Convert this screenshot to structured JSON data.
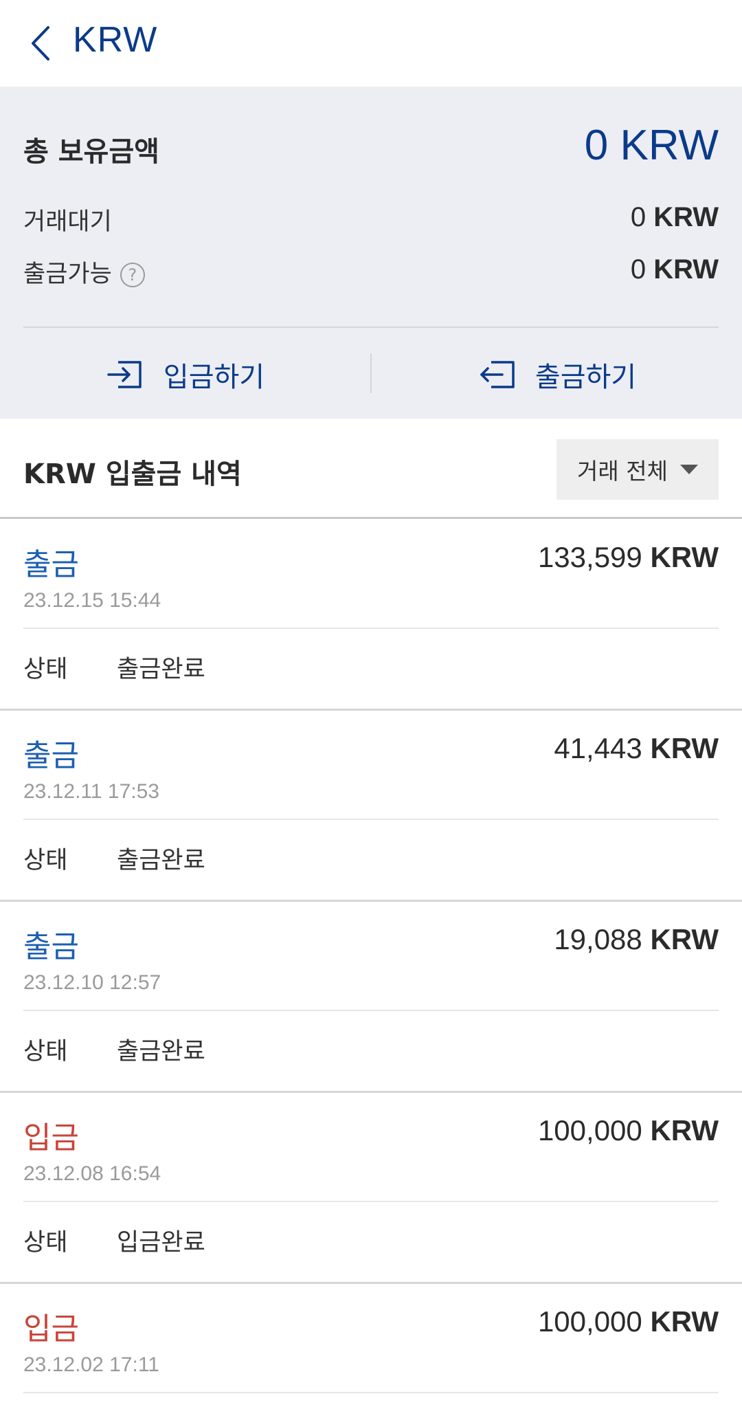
{
  "header": {
    "title": "KRW",
    "back_icon": "chevron-left-icon"
  },
  "summary": {
    "total_label": "총 보유금액",
    "total_value": "0 KRW",
    "pending_label": "거래대기",
    "pending_amount": "0",
    "pending_currency": "KRW",
    "withdrawable_label": "출금가능",
    "withdrawable_amount": "0",
    "withdrawable_currency": "KRW",
    "help_glyph": "?",
    "deposit_label": "입금하기",
    "withdraw_label": "출금하기"
  },
  "history": {
    "title": "KRW 입출금 내역",
    "filter_label": "거래 전체",
    "status_label": "상태",
    "items": [
      {
        "type": "출금",
        "kind": "out",
        "amount": "133,599",
        "currency": "KRW",
        "date": "23.12.15 15:44",
        "status": "출금완료"
      },
      {
        "type": "출금",
        "kind": "out",
        "amount": "41,443",
        "currency": "KRW",
        "date": "23.12.11 17:53",
        "status": "출금완료"
      },
      {
        "type": "출금",
        "kind": "out",
        "amount": "19,088",
        "currency": "KRW",
        "date": "23.12.10 12:57",
        "status": "출금완료"
      },
      {
        "type": "입금",
        "kind": "in",
        "amount": "100,000",
        "currency": "KRW",
        "date": "23.12.08 16:54",
        "status": "입금완료"
      },
      {
        "type": "입금",
        "kind": "in",
        "amount": "100,000",
        "currency": "KRW",
        "date": "23.12.02 17:11",
        "status": ""
      }
    ]
  },
  "colors": {
    "brand": "#0b3a8a",
    "withdraw": "#1c5fb0",
    "deposit": "#c8453a",
    "summary_bg": "#eceef3"
  }
}
